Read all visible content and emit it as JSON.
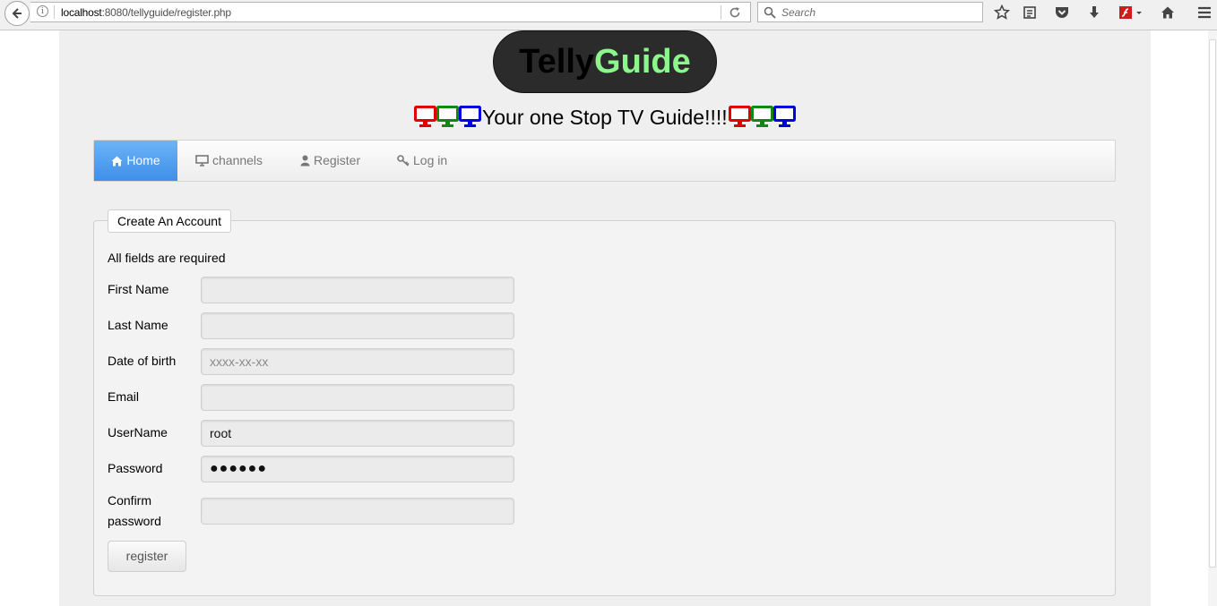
{
  "browser": {
    "url_host": "localhost",
    "url_path": ":8080/tellyguide/register.php",
    "search_placeholder": "Search"
  },
  "header": {
    "logo_part1": "Telly",
    "logo_part2": "Guide",
    "tagline": "Your one Stop TV Guide!!!!",
    "tv_colors": [
      "#e00000",
      "#118811",
      "#0000dd"
    ]
  },
  "nav": {
    "items": [
      {
        "label": "Home",
        "icon": "home-icon"
      },
      {
        "label": "channels",
        "icon": "monitor-icon"
      },
      {
        "label": "Register",
        "icon": "user-icon"
      },
      {
        "label": "Log in",
        "icon": "key-icon"
      }
    ],
    "active_color": "#4a9ef0"
  },
  "form": {
    "legend": "Create An Account",
    "required_note": "All fields are required",
    "fields": {
      "first_name": {
        "label": "First Name",
        "value": "",
        "placeholder": ""
      },
      "last_name": {
        "label": "Last Name",
        "value": "",
        "placeholder": ""
      },
      "dob": {
        "label": "Date of birth",
        "value": "",
        "placeholder": "xxxx-xx-xx"
      },
      "email": {
        "label": "Email",
        "value": "",
        "placeholder": ""
      },
      "username": {
        "label": "UserName",
        "value": "root",
        "placeholder": ""
      },
      "password": {
        "label": "Password",
        "value": "●●●●●●",
        "placeholder": ""
      },
      "confirm_password": {
        "label_line1": "Confirm",
        "label_line2": "password",
        "value": "",
        "placeholder": ""
      }
    },
    "submit_label": "register"
  }
}
